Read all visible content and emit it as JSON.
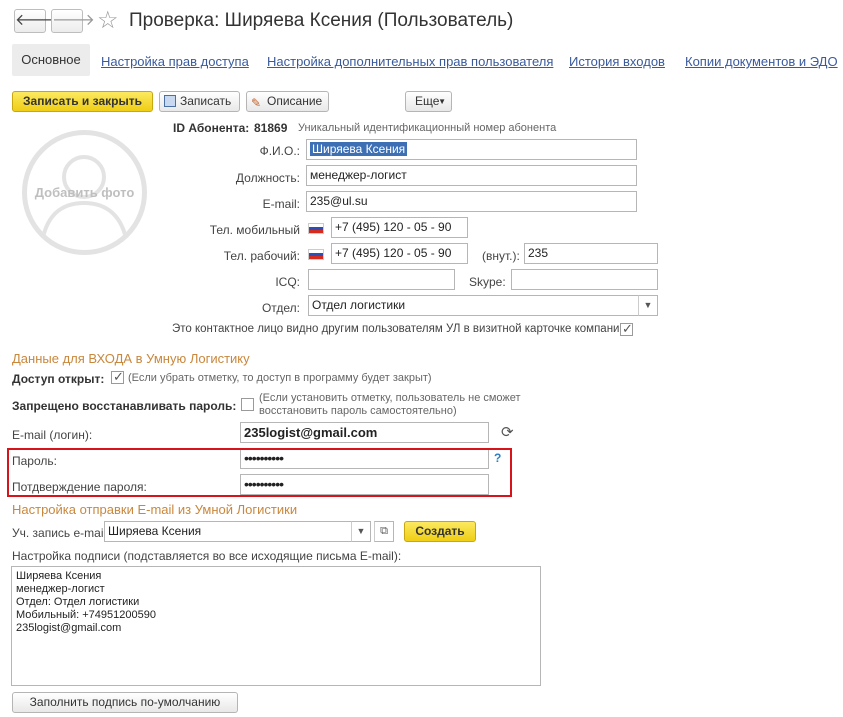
{
  "header": {
    "back_icon": "arrow-left-icon",
    "forward_icon": "arrow-right-icon",
    "star_icon": "star-icon",
    "title": "Проверка: Ширяева Ксения (Пользователь)"
  },
  "tabs": [
    {
      "label": "Основное",
      "active": true
    },
    {
      "label": "Настройка прав доступа"
    },
    {
      "label": "Настройка дополнительных прав пользователя"
    },
    {
      "label": "История входов"
    },
    {
      "label": "Копии документов и ЭДО"
    }
  ],
  "toolbar": {
    "save_close": "Записать и закрыть",
    "save": "Записать",
    "description": "Описание",
    "more": "Еще"
  },
  "photo": {
    "label": "Добавить фото"
  },
  "form": {
    "id_label": "ID Абонента:",
    "id_value": "81869",
    "id_hint": "Уникальный идентификационный номер абонента",
    "fio_label": "Ф.И.О.:",
    "fio_value": "Ширяева Ксения",
    "position_label": "Должность:",
    "position_value": "менеджер-логист",
    "email_label": "E-mail:",
    "email_value": "235@ul.su",
    "mobile_label": "Тел. мобильный",
    "mobile_value": "+7 (495) 120 - 05 - 90",
    "work_label": "Тел. рабочий:",
    "work_value": "+7 (495) 120 - 05 - 90",
    "ext_label": "(внут.):",
    "ext_value": "235",
    "icq_label": "ICQ:",
    "icq_value": "",
    "skype_label": "Skype:",
    "skype_value": "",
    "dept_label": "Отдел:",
    "dept_value": "Отдел логистики",
    "visible_label": "Это контактное лицо видно другим пользователям УЛ в визитной карточке компании:",
    "visible_checked": true
  },
  "login": {
    "section_title": "Данные для ВХОДА в Умную Логистику",
    "access_label": "Доступ открыт:",
    "access_checked": true,
    "access_hint": "(Если убрать отметку, то доступ в программу будет закрыт)",
    "restore_label": "Запрещено восстанавливать пароль:",
    "restore_checked": false,
    "restore_hint_1": "(Если установить отметку, пользователь не сможет",
    "restore_hint_2": "восстановить пароль самостоятельно)",
    "login_label": "E-mail (логин):",
    "login_value": "235logist@gmail.com",
    "password_label": "Пароль:",
    "password_value": "••••••••••",
    "help": "?",
    "confirm_label": "Потдверждение пароля:",
    "confirm_value": "••••••••••"
  },
  "mail": {
    "section_title": "Настройка отправки E-mail из Умной Логистики",
    "account_label": "Уч. запись e-mail:",
    "account_value": "Ширяева Ксения",
    "create": "Создать",
    "signature_label": "Настройка подписи (подставляется во все исходящие письма E-mail):",
    "signature_lines": [
      "Ширяева Ксения",
      "менеджер-логист",
      "Отдел: Отдел логистики",
      "Мобильный: +74951200590",
      "235logist@gmail.com"
    ],
    "fill_default": "Заполнить подпись по-умолчанию"
  }
}
